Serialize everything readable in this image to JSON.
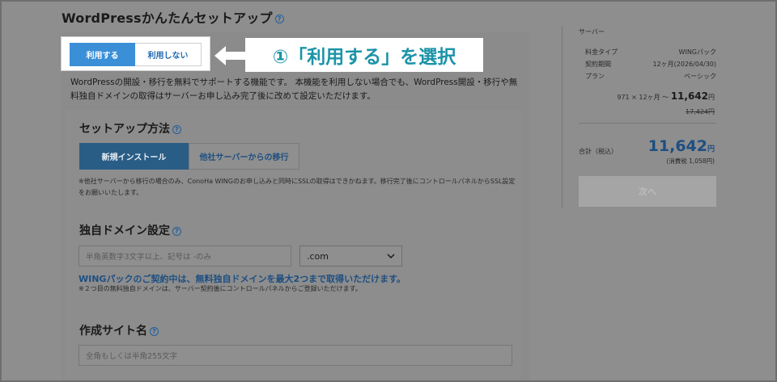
{
  "page_title": "WordPressかんたんセットアップ",
  "help_glyph": "?",
  "usage_toggle": {
    "use_label": "利用する",
    "no_use_label": "利用しない"
  },
  "callout": "①「利用する」を選択",
  "description": "WordPressの開設・移行を無料でサポートする機能です。 本機能を利用しない場合でも、WordPress開設・移行や無料独自ドメインの取得はサーバーお申し込み完了後に改めて設定いただけます。",
  "setup_method": {
    "title": "セットアップ方法",
    "tab_new": "新規インストール",
    "tab_migrate": "他社サーバーからの移行",
    "note": "※他社サーバーから移行の場合のみ、ConoHa WINGのお申し込みと同時にSSLの取得はできかねます。移行完了後にコントロールパネルからSSL設定をお願いいたします。"
  },
  "domain": {
    "title": "独自ドメイン設定",
    "placeholder": "半角英数字3文字以上、記号は -のみ",
    "tld_value": ".com",
    "blue_note": "WINGパックのご契約中は、無料独自ドメインを最大2つまで取得いただけます。",
    "small_note": "※２つ目の無料独自ドメインは、サーバー契約後にコントロールパネルからご登録いただけます。"
  },
  "site_name": {
    "title": "作成サイト名",
    "placeholder": "全角もしくは半角255文字"
  },
  "summary": {
    "header": "サーバー",
    "rows": [
      {
        "label": "料金タイプ",
        "value": "WINGパック"
      },
      {
        "label": "契約期間",
        "value": "12ヶ月(2026/04/30)"
      },
      {
        "label": "プラン",
        "value": "ベーシック"
      }
    ],
    "calc_prefix": "971 × 12ヶ月 ～",
    "calc_value": "11,642",
    "calc_unit": "円",
    "original_price": "17,424円",
    "total_label": "合計（税込）",
    "total_value": "11,642",
    "total_unit": "円",
    "tax_note": "(消費税 1,058円)",
    "next_label": "次へ"
  },
  "colors": {
    "accent": "#3a8fd7",
    "callout_text": "#1b93a8",
    "link": "#1d4f82"
  }
}
